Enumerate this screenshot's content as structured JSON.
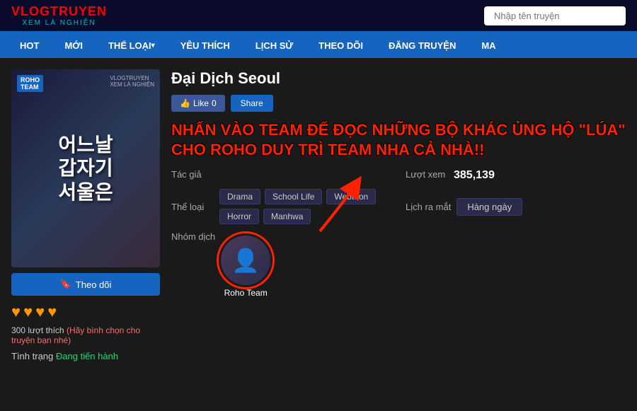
{
  "site": {
    "logo_top": "VLOGTRUYEN",
    "logo_bottom": "XEM LÀ NGHIỆN",
    "search_placeholder": "Nhập tên truyện"
  },
  "nav": {
    "items": [
      {
        "label": "HOT",
        "arrow": false
      },
      {
        "label": "MỚI",
        "arrow": false
      },
      {
        "label": "THỂ LOẠI",
        "arrow": true
      },
      {
        "label": "YÊU THÍCH",
        "arrow": false
      },
      {
        "label": "LỊCH SỬ",
        "arrow": false
      },
      {
        "label": "THEO DÕI",
        "arrow": false
      },
      {
        "label": "ĐĂNG TRUYỆN",
        "arrow": false
      },
      {
        "label": "MA",
        "arrow": false
      }
    ]
  },
  "manga": {
    "title": "Đại Dịch Seoul",
    "like_label": "Like",
    "like_count": "0",
    "share_label": "Share",
    "announcement": "NHẤN VÀO TEAM ĐỂ ĐỌC NHỮNG BỘ KHÁC ỦNG HỘ \"LÚA\" CHO ROHO DUY TRÌ TEAM NHA CẢ NHÀ!!",
    "author_label": "Tác giả",
    "author_value": "",
    "genre_label": "Thể loại",
    "tags": [
      "Drama",
      "School Life",
      "Webtoon",
      "Horror",
      "Manhwa"
    ],
    "group_label": "Nhóm dịch",
    "team_name": "Roho Team",
    "views_label": "Lượt xem",
    "views_value": "385,139",
    "schedule_label": "Lịch ra mắt",
    "schedule_value": "Hàng ngày",
    "follow_btn": "Theo dõi",
    "status_label": "Tình trạng",
    "status_value": "Đang tiến hành",
    "likes_text": "300 lượt thích",
    "likes_action": "(Hãy bình chọn cho truyện bạn nhé)",
    "stars": [
      "★",
      "★",
      "★",
      "★"
    ]
  }
}
